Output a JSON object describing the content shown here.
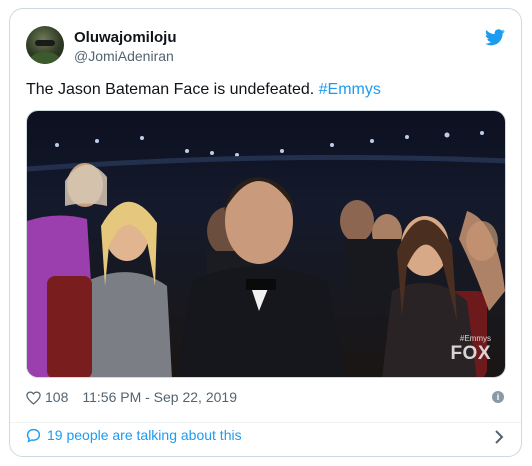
{
  "tweet": {
    "author_name": "Oluwajomiloju",
    "author_handle": "@JomiAdeniran",
    "text_main": "The Jason Bateman Face is undefeated. ",
    "text_hashtag": "#Emmys",
    "likes": "108",
    "timestamp": "11:56 PM - Sep 22, 2019",
    "conversation_link": "19 people are talking about this"
  },
  "media": {
    "watermark_tag": "#Emmys",
    "watermark_network": "FOX"
  },
  "icons": {
    "brand": "bird-icon",
    "like": "heart-icon",
    "info": "info-icon",
    "conversation": "speech-bubble-icon",
    "navigate": "chevron-right-icon"
  },
  "colors": {
    "accent": "#1d9bf0",
    "text_primary": "#0f1419",
    "text_secondary": "#536471",
    "border": "#cfd9de"
  }
}
